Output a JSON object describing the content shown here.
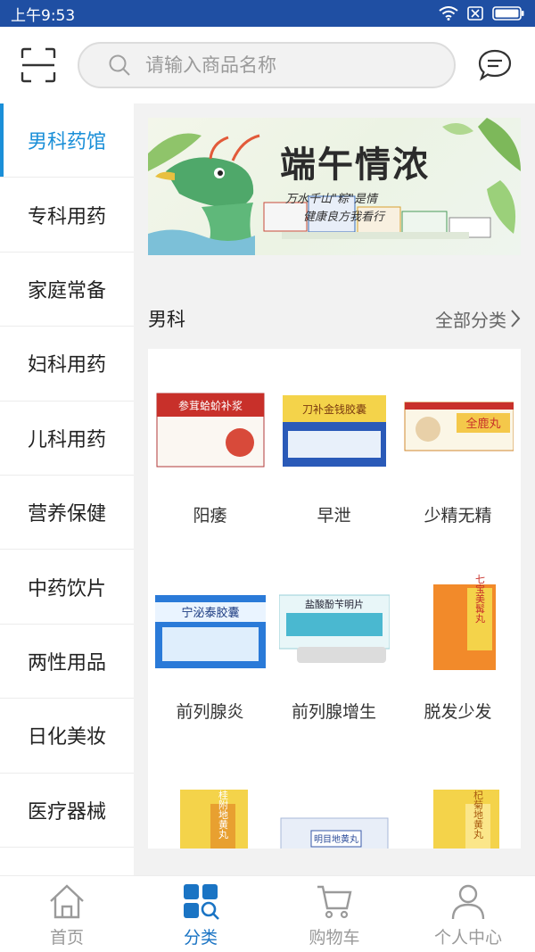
{
  "status_bar": {
    "time": "上午9:53"
  },
  "header": {
    "search_placeholder": "请输入商品名称"
  },
  "sidebar": {
    "items": [
      {
        "label": "男科药馆",
        "active": true
      },
      {
        "label": "专科用药"
      },
      {
        "label": "家庭常备"
      },
      {
        "label": "妇科用药"
      },
      {
        "label": "儿科用药"
      },
      {
        "label": "营养保健"
      },
      {
        "label": "中药饮片"
      },
      {
        "label": "两性用品"
      },
      {
        "label": "日化美妆"
      },
      {
        "label": "医疗器械"
      }
    ]
  },
  "banner": {
    "title": "端午情浓",
    "line1": "万水千山\"粽\"是情",
    "line2": "健康良方我看行"
  },
  "section": {
    "title": "男科",
    "all_label": "全部分类"
  },
  "products": [
    {
      "label": "阳痿",
      "box_text": "参茸蛤蚧补浆"
    },
    {
      "label": "早泄",
      "box_text": "刀补金钱胶囊"
    },
    {
      "label": "少精无精",
      "box_text": "全鹿丸"
    },
    {
      "label": "前列腺炎",
      "box_text": "宁泌泰胶囊"
    },
    {
      "label": "前列腺增生",
      "box_text": "盐酸酚苄明片"
    },
    {
      "label": "脱发少发",
      "box_text": "七宝美髯丸"
    },
    {
      "label": "",
      "box_text": "桂附地黄丸"
    },
    {
      "label": "",
      "box_text": "明目地黄丸"
    },
    {
      "label": "",
      "box_text": "杞菊地黄丸"
    }
  ],
  "bottom_nav": {
    "items": [
      {
        "label": "首页",
        "icon": "home-icon"
      },
      {
        "label": "分类",
        "icon": "category-icon",
        "active": true
      },
      {
        "label": "购物车",
        "icon": "cart-icon"
      },
      {
        "label": "个人中心",
        "icon": "user-icon"
      }
    ]
  },
  "colors": {
    "status_bar": "#1f4fa3",
    "accent": "#1a8fd8",
    "nav_active": "#1a74c4"
  }
}
